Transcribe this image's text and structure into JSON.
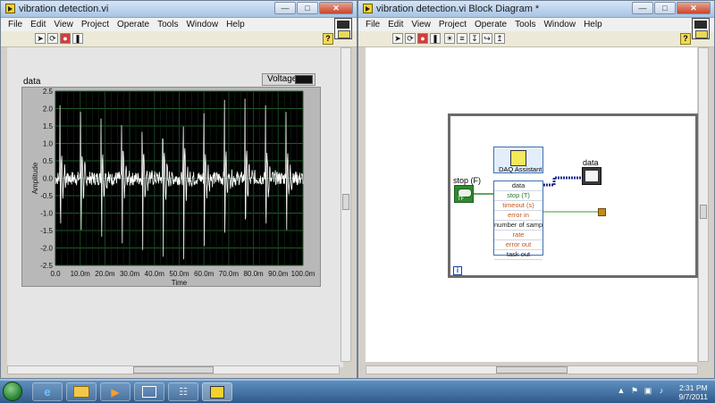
{
  "front_panel": {
    "title": "vibration detection.vi",
    "menu": [
      "File",
      "Edit",
      "View",
      "Project",
      "Operate",
      "Tools",
      "Window",
      "Help"
    ],
    "help_label": "?",
    "graph": {
      "label": "data",
      "legend": "Voltage",
      "plot_color": "#ffffff",
      "background_color": "#000000",
      "grid_color": "#1f5a2a"
    }
  },
  "block_diagram": {
    "title": "vibration detection.vi Block Diagram *",
    "menu": [
      "File",
      "Edit",
      "View",
      "Project",
      "Operate",
      "Tools",
      "Window",
      "Help"
    ],
    "help_label": "?",
    "stop_label": "stop (F)",
    "stop_tf": "TF",
    "data_label": "data",
    "loop_iteration": "i",
    "daq": {
      "title": "DAQ Assistant",
      "terminals": [
        {
          "label": "data",
          "color": "dark"
        },
        {
          "label": "stop (T)",
          "color": "green"
        },
        {
          "label": "timeout (s)",
          "color": "orange"
        },
        {
          "label": "error in",
          "color": "orange"
        },
        {
          "label": "number of samp",
          "color": "dark"
        },
        {
          "label": "rate",
          "color": "orange"
        },
        {
          "label": "error out",
          "color": "orange"
        },
        {
          "label": "task out",
          "color": "dark"
        }
      ]
    }
  },
  "chart_data": {
    "type": "line",
    "title": "",
    "xlabel": "Time",
    "ylabel": "Amplitude",
    "xlim": [
      0,
      0.1
    ],
    "ylim": [
      -2.5,
      2.5
    ],
    "x_ticks": [
      "0.0",
      "10.0m",
      "20.0m",
      "30.0m",
      "40.0m",
      "50.0m",
      "60.0m",
      "70.0m",
      "80.0m",
      "90.0m",
      "100.0m"
    ],
    "y_ticks": [
      "2.5",
      "2.0",
      "1.5",
      "1.0",
      "0.5",
      "0.0",
      "-0.5",
      "-1.0",
      "-1.5",
      "-2.0",
      "-2.5"
    ],
    "grid": true,
    "series": [
      {
        "pulse_period": 0.0083,
        "pulse_first_time": 0.0017,
        "pulse_peak": 2.4,
        "pulse_trough": -2.4,
        "baseline_noise": 0.25
      }
    ]
  },
  "taskbar": {
    "time": "2:31 PM",
    "date": "9/7/2011",
    "buttons": [
      "ie-icon",
      "explorer-icon",
      "media-player-icon",
      "window-icon",
      "network-icon",
      "labview-icon"
    ]
  }
}
